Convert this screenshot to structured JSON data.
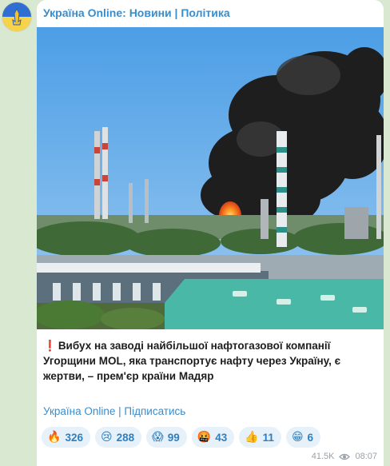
{
  "channel": {
    "name": "Україна Online: Новини | Політика",
    "subscribe_link": "Україна Online | Підписатись"
  },
  "post": {
    "marker": "❗",
    "text": "Вибух на заводі найбільшої нафтогазової компанії Угорщини MOL, яка транспортує нафту через Україну, є жертви, – прем'єр країни Мадяр"
  },
  "reactions": [
    {
      "emoji": "🔥",
      "icon": "fire-icon",
      "count": "326"
    },
    {
      "emoji": "😢",
      "icon": "crying-face-icon",
      "count": "288"
    },
    {
      "emoji": "😱",
      "icon": "screaming-face-icon",
      "count": "99"
    },
    {
      "emoji": "🤬",
      "icon": "angry-face-icon",
      "count": "43"
    },
    {
      "emoji": "👍",
      "icon": "thumbs-up-icon",
      "count": "11"
    },
    {
      "emoji": "😁",
      "icon": "grinning-face-icon",
      "count": "6"
    }
  ],
  "meta": {
    "views": "41.5K",
    "time": "08:07"
  },
  "colors": {
    "chat_bg": "#d9e8d0",
    "link": "#3a8dcb",
    "reaction_bg": "#e6f1fa",
    "marker": "#d8202a"
  }
}
